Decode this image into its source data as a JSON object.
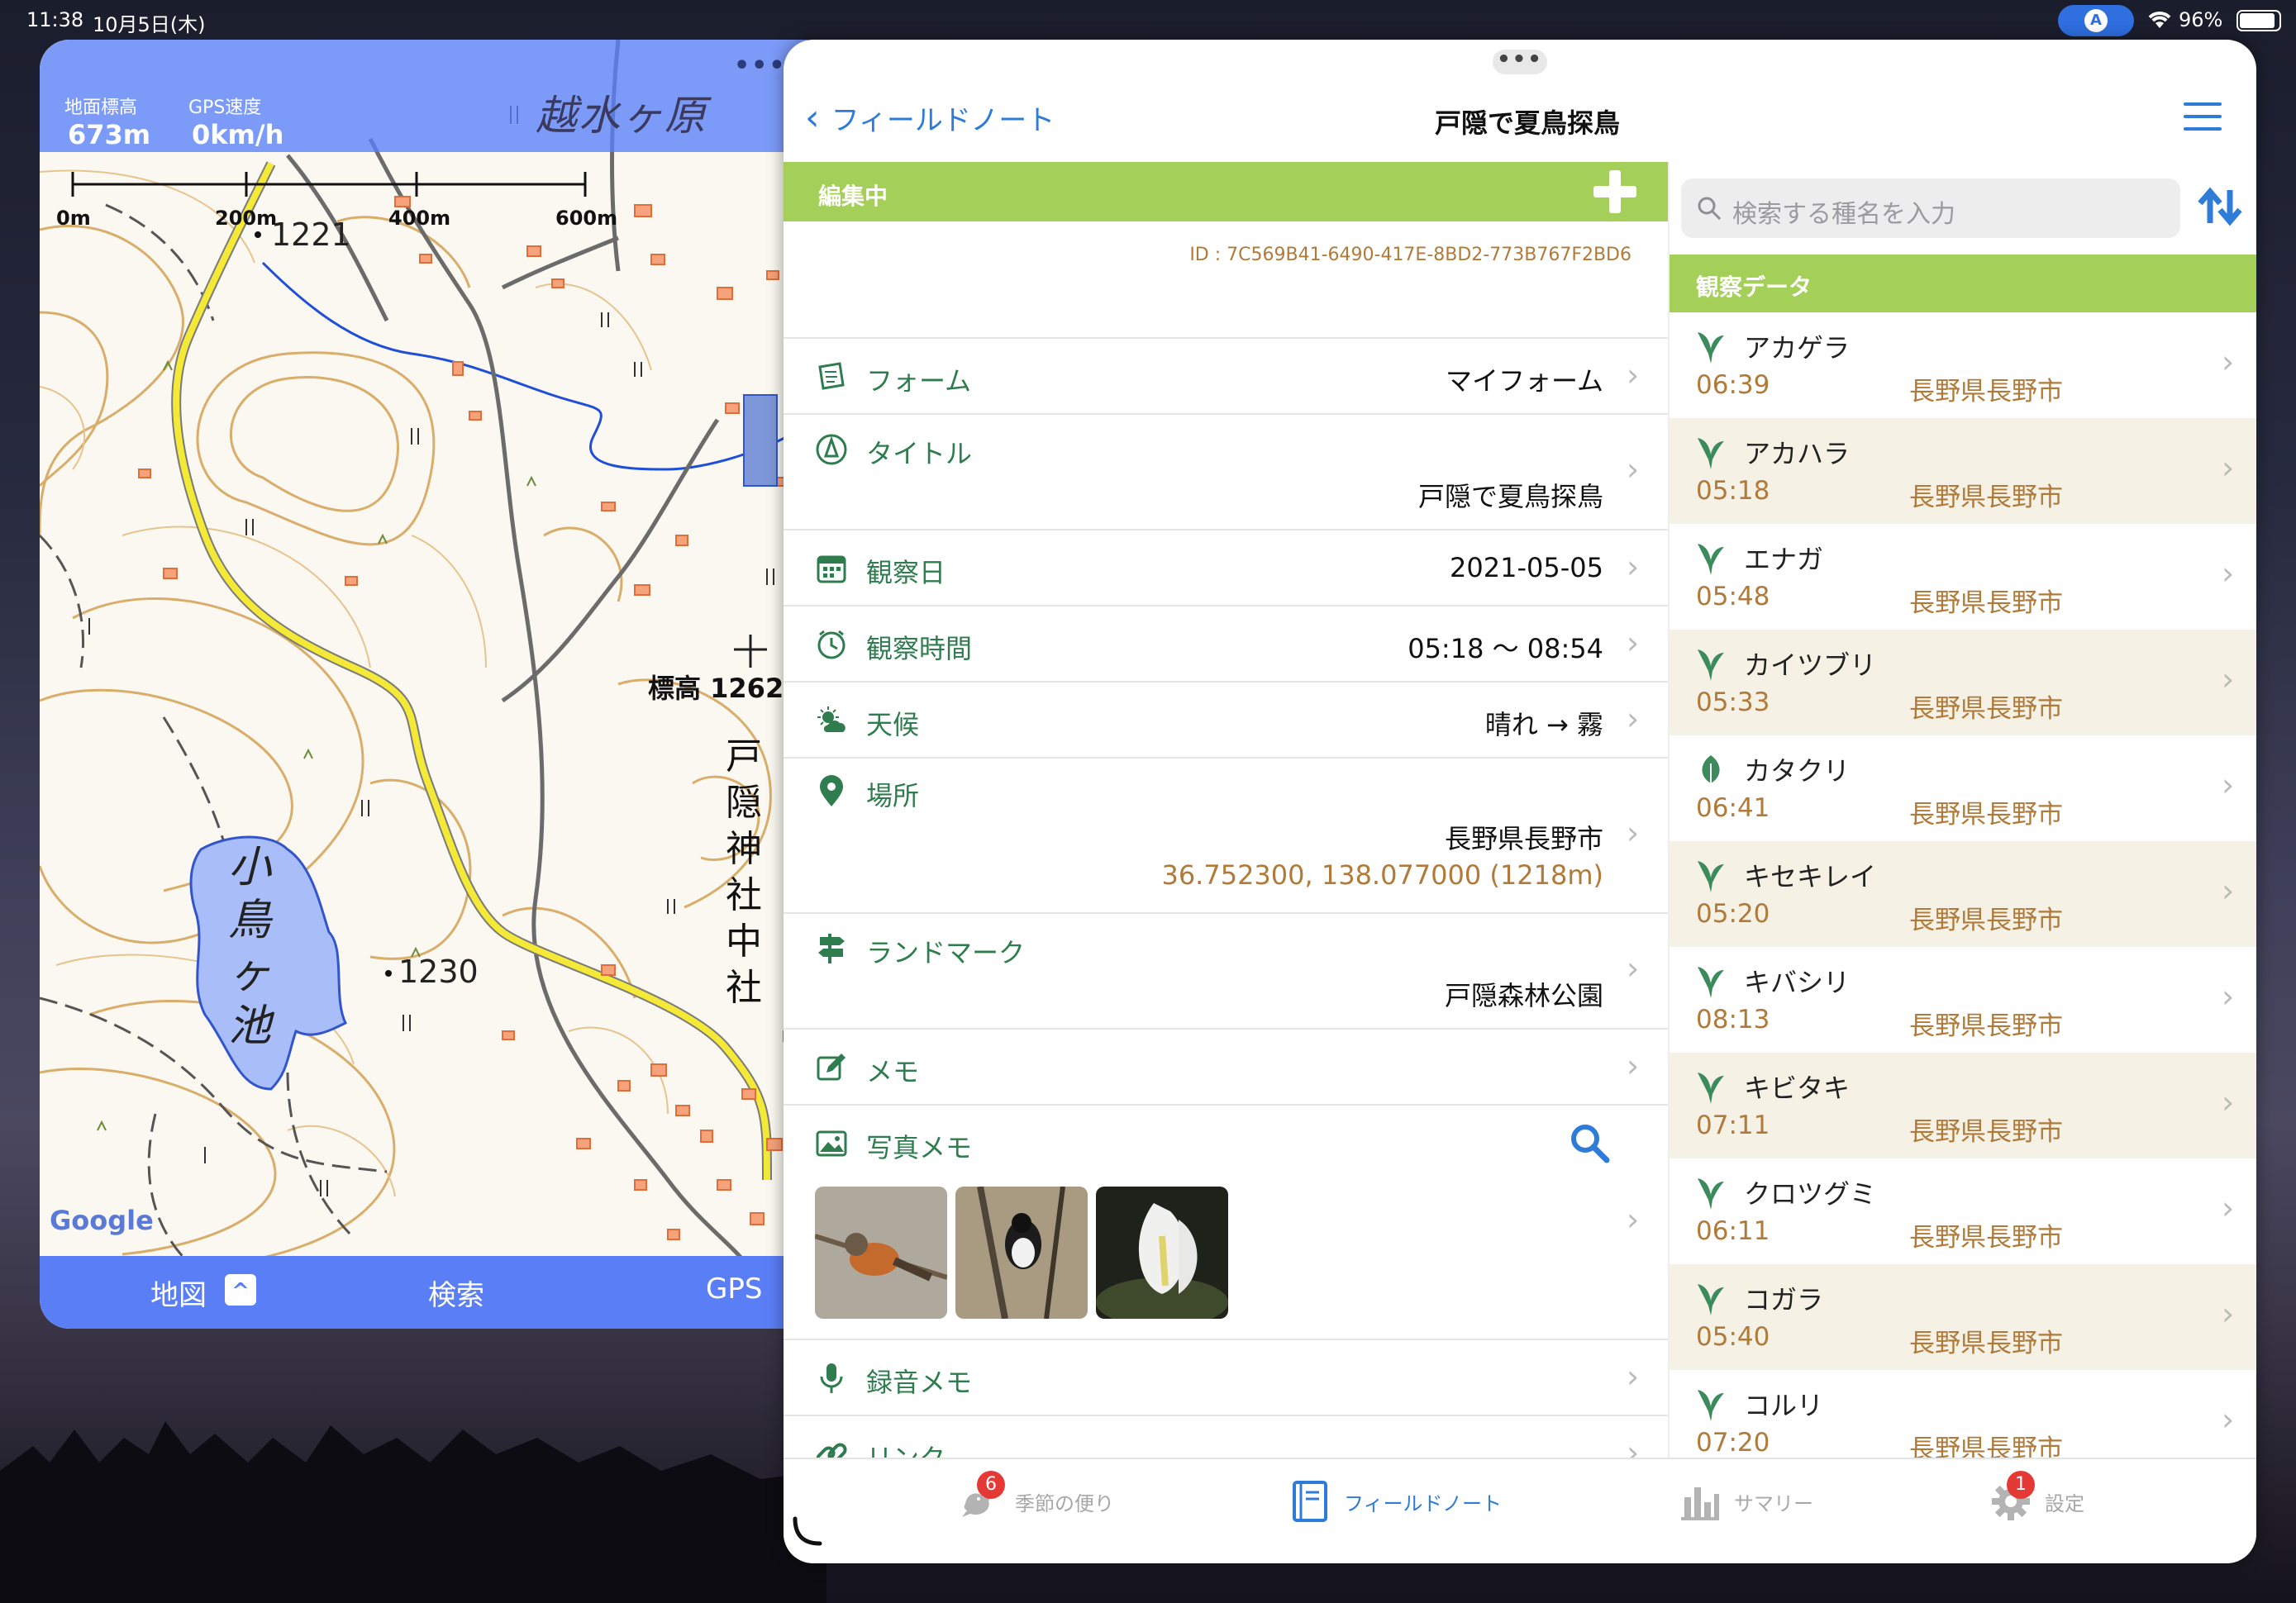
{
  "status": {
    "time": "11:38",
    "date": "10月5日(木)",
    "location_indicator": "A",
    "battery": "96%"
  },
  "map": {
    "elevation_label": "地面標高",
    "elevation_value": "673m",
    "speed_label": "GPS速度",
    "speed_value": "0km/h",
    "scale_labels": [
      "0m",
      "200m",
      "400m",
      "600m"
    ],
    "place_labels": {
      "koshimizugahara": "越水ヶ原",
      "kotorigaike": "小鳥ヶ池",
      "togakushi_chusha": "戸隠神社中社",
      "elev_point": "標高 1262",
      "pt_1221": "1221",
      "pt_1230": "1230"
    },
    "attribution": "Google",
    "bottom_bar": {
      "map": "地図",
      "search": "検索",
      "gps": "GPS"
    }
  },
  "note": {
    "back_label": "フィールドノート",
    "title": "戸隠で夏鳥探鳥",
    "editing_label": "編集中",
    "id_text": "ID : 7C569B41-6490-417E-8BD2-773B767F2BD6",
    "rows": {
      "form": {
        "label": "フォーム",
        "value": "マイフォーム",
        "icon": "form-icon"
      },
      "title": {
        "label": "タイトル",
        "value": "戸隠で夏鳥探鳥",
        "icon": "title-icon"
      },
      "date": {
        "label": "観察日",
        "value": "2021-05-05",
        "icon": "calendar-icon"
      },
      "time": {
        "label": "観察時間",
        "value": "05:18 〜 08:54",
        "icon": "clock-icon"
      },
      "weather": {
        "label": "天候",
        "value": "晴れ → 霧",
        "icon": "weather-icon"
      },
      "place": {
        "label": "場所",
        "value": "長野県長野市",
        "coords": "36.752300, 138.077000 (1218m)",
        "icon": "pin-icon"
      },
      "landmark": {
        "label": "ランドマーク",
        "value": "戸隠森林公園",
        "icon": "signpost-icon"
      },
      "memo": {
        "label": "メモ",
        "icon": "pencil-icon"
      },
      "photo": {
        "label": "写真メモ",
        "icon": "photo-icon"
      },
      "audio": {
        "label": "録音メモ",
        "icon": "mic-icon"
      },
      "link": {
        "label": "リンク",
        "icon": "link-icon"
      }
    },
    "search_placeholder": "検索する種名を入力",
    "obs_header": "観察データ",
    "species": [
      {
        "name": "アカゲラ",
        "time": "06:39",
        "place": "長野県長野市",
        "kind": "bird"
      },
      {
        "name": "アカハラ",
        "time": "05:18",
        "place": "長野県長野市",
        "kind": "bird"
      },
      {
        "name": "エナガ",
        "time": "05:48",
        "place": "長野県長野市",
        "kind": "bird"
      },
      {
        "name": "カイツブリ",
        "time": "05:33",
        "place": "長野県長野市",
        "kind": "bird"
      },
      {
        "name": "カタクリ",
        "time": "06:41",
        "place": "長野県長野市",
        "kind": "plant"
      },
      {
        "name": "キセキレイ",
        "time": "05:20",
        "place": "長野県長野市",
        "kind": "bird"
      },
      {
        "name": "キバシリ",
        "time": "08:13",
        "place": "長野県長野市",
        "kind": "bird"
      },
      {
        "name": "キビタキ",
        "time": "07:11",
        "place": "長野県長野市",
        "kind": "bird"
      },
      {
        "name": "クロツグミ",
        "time": "06:11",
        "place": "長野県長野市",
        "kind": "bird"
      },
      {
        "name": "コガラ",
        "time": "05:40",
        "place": "長野県長野市",
        "kind": "bird"
      },
      {
        "name": "コルリ",
        "time": "07:20",
        "place": "長野県長野市",
        "kind": "bird"
      }
    ],
    "tabs": {
      "season": {
        "label": "季節の便り",
        "badge": "6"
      },
      "fieldnote": {
        "label": "フィールドノート"
      },
      "summary": {
        "label": "サマリー"
      },
      "settings": {
        "label": "設定",
        "badge": "1"
      }
    }
  },
  "colors": {
    "accent": "#2e7bd8",
    "green_bar": "#a4cf58",
    "label_green": "#2f7c4f",
    "brown": "#b07a3a",
    "map_blue": "#5a7ef6"
  }
}
